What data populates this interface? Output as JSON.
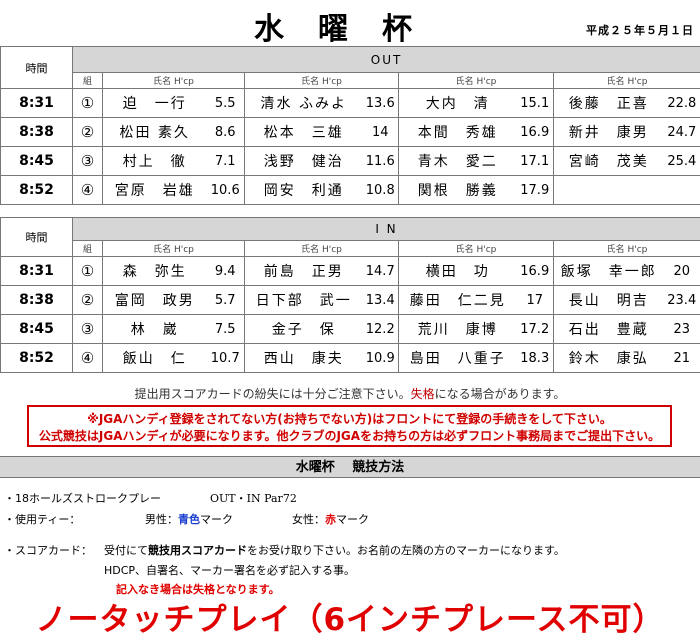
{
  "header": {
    "title": "水曜杯",
    "date": "平成２５年５月１日"
  },
  "out": {
    "label": "OUT",
    "time_header": "時間",
    "group_header": "組",
    "col_header": "氏名 H'cp",
    "rows": [
      {
        "time": "8:31",
        "group": "①",
        "players": [
          {
            "name": "迫　一行",
            "hcp": "5.5"
          },
          {
            "name": "清水 ふみよ",
            "hcp": "13.6"
          },
          {
            "name": "大内　清",
            "hcp": "15.1"
          },
          {
            "name": "後藤　正喜",
            "hcp": "22.8"
          }
        ]
      },
      {
        "time": "8:38",
        "group": "②",
        "players": [
          {
            "name": "松田 素久",
            "hcp": "8.6"
          },
          {
            "name": "松本　三雄",
            "hcp": "14"
          },
          {
            "name": "本間　秀雄",
            "hcp": "16.9"
          },
          {
            "name": "新井　康男",
            "hcp": "24.7"
          }
        ]
      },
      {
        "time": "8:45",
        "group": "③",
        "players": [
          {
            "name": "村上　徹",
            "hcp": "7.1"
          },
          {
            "name": "浅野　健治",
            "hcp": "11.6"
          },
          {
            "name": "青木　愛二",
            "hcp": "17.1"
          },
          {
            "name": "宮崎　茂美",
            "hcp": "25.4"
          }
        ]
      },
      {
        "time": "8:52",
        "group": "④",
        "players": [
          {
            "name": "宮原　岩雄",
            "hcp": "10.6"
          },
          {
            "name": "岡安　利通",
            "hcp": "10.8"
          },
          {
            "name": "関根　勝義",
            "hcp": "17.9"
          },
          {
            "name": "",
            "hcp": ""
          }
        ]
      }
    ]
  },
  "in": {
    "label": "I N",
    "time_header": "時間",
    "group_header": "組",
    "col_header": "氏名 H'cp",
    "rows": [
      {
        "time": "8:31",
        "group": "①",
        "players": [
          {
            "name": "森　弥生",
            "hcp": "9.4"
          },
          {
            "name": "前島　正男",
            "hcp": "14.7"
          },
          {
            "name": "横田　功",
            "hcp": "16.9"
          },
          {
            "name": "飯塚　幸一郎",
            "hcp": "20"
          }
        ]
      },
      {
        "time": "8:38",
        "group": "②",
        "players": [
          {
            "name": "富岡　政男",
            "hcp": "5.7"
          },
          {
            "name": "日下部　武一",
            "hcp": "13.4"
          },
          {
            "name": "藤田　仁二見",
            "hcp": "17"
          },
          {
            "name": "長山　明吉",
            "hcp": "23.4"
          }
        ]
      },
      {
        "time": "8:45",
        "group": "③",
        "players": [
          {
            "name": "林　崴",
            "hcp": "7.5"
          },
          {
            "name": "金子　保",
            "hcp": "12.2"
          },
          {
            "name": "荒川　康博",
            "hcp": "17.2"
          },
          {
            "name": "石出　豊蔵",
            "hcp": "23"
          }
        ]
      },
      {
        "time": "8:52",
        "group": "④",
        "players": [
          {
            "name": "飯山　仁",
            "hcp": "10.7"
          },
          {
            "name": "西山　康夫",
            "hcp": "10.9"
          },
          {
            "name": "島田　八重子",
            "hcp": "18.3"
          },
          {
            "name": "鈴木　康弘",
            "hcp": "21"
          }
        ]
      }
    ]
  },
  "notice": {
    "before": "提出用スコアカードの紛失には十分ご注意下さい。",
    "red": "失格",
    "after": "になる場合があります。"
  },
  "warning": {
    "line1": "※JGAハンディ登録をされてない方(お持ちでない方)はフロントにて登録の手続きをして下さい。",
    "line2": "公式競技はJGAハンディが必要になります。他クラブのJGAをお持ちの方は必ずフロント事務局までご提出下さい。"
  },
  "method": {
    "title": "水曜杯　 競技方法",
    "format_label": "・18ホールズストロークプレー",
    "format_value": "OUT・IN  Par72",
    "tee_label": "・使用ティー：",
    "men_label": "男性：",
    "men_color": "青色",
    "men_suffix": "マーク",
    "women_label": "女性：",
    "women_color": "赤",
    "women_suffix": "マーク",
    "card_label": "・スコアカード：",
    "card_line1_a": "受付にて",
    "card_line1_b": "競技用スコアカード",
    "card_line1_c": "をお受け取り下さい。お名前の左隣の方のマーカーになります。",
    "card_line2": "HDCP、自署名、マーカー署名を必ず記入する事。",
    "card_line3": "記入なき場合は失格となります。"
  },
  "banner": "ノータッチプレイ（6インチプレース不可）",
  "colors": {
    "accent_red": "#e00000",
    "blue": "#1a3fcf",
    "band_gray": "#d6d6d6"
  }
}
